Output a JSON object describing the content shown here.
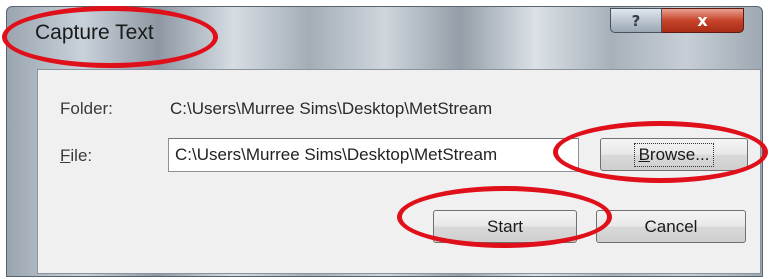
{
  "window": {
    "title": "Capture Text",
    "help_icon": "?",
    "close_icon": "x"
  },
  "dialog": {
    "folder_label_mnemonic": "",
    "folder_label_rest": "Folder:",
    "folder_value": "C:\\Users\\Murree Sims\\Desktop\\MetStream",
    "file_label_mnemonic": "F",
    "file_label_rest": "ile:",
    "file_value": "C:\\Users\\Murree Sims\\Desktop\\MetStream",
    "browse_label_mnemonic": "B",
    "browse_label_rest": "rowse...",
    "start_label": "Start",
    "cancel_label": "Cancel"
  },
  "icons": {
    "help": "help-icon",
    "close": "close-icon"
  },
  "colors": {
    "highlight_oval": "#e0101a",
    "close_button": "#c6442a"
  }
}
